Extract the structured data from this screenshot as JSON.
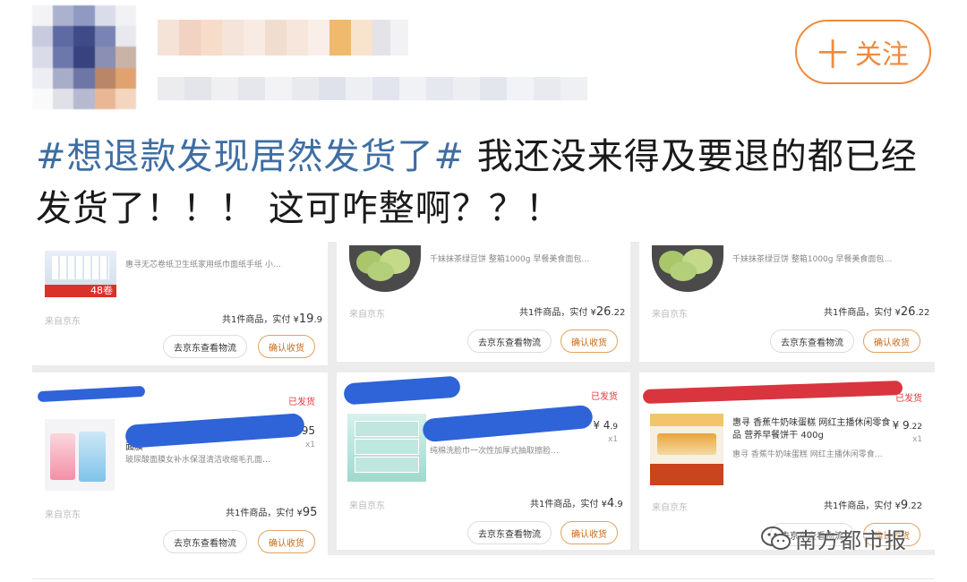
{
  "follow_button": {
    "plus": "十",
    "label": "关注"
  },
  "post": {
    "hashtag": "#想退款发现居然发货了#",
    "text_line1": " 我还没来得及要退的都已经",
    "text_line2": "发货了！！！ 这可咋整啊？？！"
  },
  "orders": [
    {
      "title": "惠寻无芯卷纸卫生纸家用纸巾面纸手纸 小…",
      "badge": "48卷",
      "source": "来自京东",
      "total_prefix": "共1件商品，实付 ¥",
      "total_int": "19",
      "total_dec": ".9",
      "logistics_label": "去京东查看物流",
      "confirm_label": "确认收货"
    },
    {
      "title": "千妹抹茶绿豆饼 整箱1000g 早餐美食面包…",
      "source": "来自京东",
      "total_prefix": "共1件商品，实付 ¥",
      "total_int": "26",
      "total_dec": ".22",
      "logistics_label": "去京东查看物流",
      "confirm_label": "确认收货"
    },
    {
      "title": "千妹抹茶绿豆饼 整箱1000g 早餐美食面包…",
      "source": "来自京东",
      "total_prefix": "共1件商品，实付 ¥",
      "total_int": "26",
      "total_dec": ".22",
      "logistics_label": "去京东查看物流",
      "confirm_label": "确认收货"
    },
    {
      "status": "已发货",
      "title_partial": "面膜",
      "subtitle": "玻尿酸面膜女补水保湿清洁收缩毛孔面…",
      "price": "95",
      "qty": "x1",
      "source": "来自京东",
      "total_prefix": "共1件商品，实付 ¥",
      "total_int": "95",
      "total_dec": "",
      "logistics_label": "去京东查看物流",
      "confirm_label": "确认收货"
    },
    {
      "status": "已发货",
      "subtitle": "纯棉洗脸巾一次性加厚式抽取擦脸…",
      "price_int": "4",
      "price_dec": ".9",
      "qty": "x1",
      "source": "来自京东",
      "total_prefix": "共1件商品，实付 ¥",
      "total_int": "4",
      "total_dec": ".9",
      "logistics_label": "去京东查看物流",
      "confirm_label": "确认收货"
    },
    {
      "status": "已发货",
      "title": "惠寻 香蕉牛奶味蛋糕 网红主播休闲零食品 营养早餐饼干 400g",
      "subtitle": "惠寻 香蕉牛奶味蛋糕 网红主播休闲零食…",
      "price_int": "9",
      "price_dec": ".22",
      "qty": "x1",
      "source": "来自京东",
      "total_prefix": "共1件商品，实付 ¥",
      "total_int": "9",
      "total_dec": ".22",
      "logistics_label": "去京东查看物流",
      "confirm_label": "确认收货"
    }
  ],
  "watermark": {
    "text": "南方都市报"
  }
}
